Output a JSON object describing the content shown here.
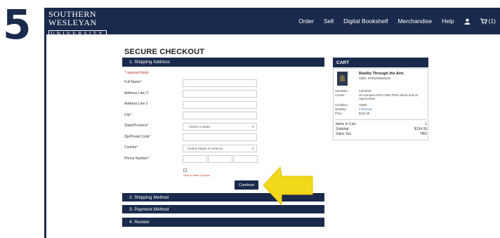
{
  "step_number": "5",
  "logo": {
    "line1": "SOUTHERN",
    "line2": "WESLEYAN",
    "line3": "UNIVERSITY"
  },
  "nav": {
    "items": [
      "Order",
      "Sell",
      "Digital Bookshelf",
      "Merchandise",
      "Help"
    ],
    "user_icon": "user-icon",
    "cart_icon": "cart-icon",
    "cart_count": "(1)"
  },
  "page_title": "SECURE CHECKOUT",
  "sections": {
    "shipping_address": "1. Shipping Address",
    "shipping_method": "2. Shipping Method",
    "payment_method": "3. Payment Method",
    "review": "4. Review"
  },
  "form": {
    "required_note": "* required fields",
    "fields": {
      "full_name": "Full Name",
      "address1": "Address Line 1",
      "address2": "Address Line 2",
      "city": "City",
      "state": "State/Province",
      "zip": "Zip/Postal Code",
      "country": "Country",
      "phone": "Phone Number"
    },
    "required_marker": "*",
    "state_value": "--Select a State--",
    "country_value": "United States of America",
    "ship_to_campus": "Ship to Main Campus",
    "continue_label": "Continue"
  },
  "cart": {
    "header": "CART",
    "book_title": "Reality Through the Arts",
    "isbn": "ISBN: 9780205858224",
    "labels": {
      "semester": "Semester:",
      "course": "Course:",
      "condition": "Condition:",
      "quantity": "Quantity:",
      "price": "Price:"
    },
    "semester": "Fall 2019",
    "course": "On-Campus-ASTH 2053 FRSA Music and Art Appreciation",
    "condition": "USED",
    "quantity": "1 Remove",
    "price": "$134.39",
    "totals": {
      "items_label": "Items in Cart:",
      "items_value": "1",
      "subtotal_label": "Subtotal:",
      "subtotal_value": "$134.39",
      "tax_label": "Sales Tax:",
      "tax_value": "TBD"
    }
  },
  "colors": {
    "navy": "#1a2a4c",
    "required_red": "#c0392b",
    "arrow_yellow": "#f2d81b"
  }
}
